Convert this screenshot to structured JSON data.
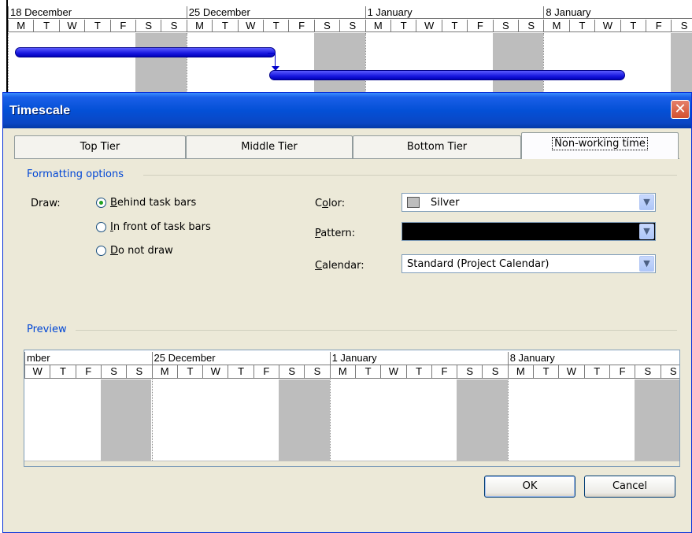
{
  "window": {
    "title": "Timescale",
    "close_glyph": "✕"
  },
  "timescale": {
    "weeks": [
      "18 December",
      "25 December",
      "1 January",
      "8 January"
    ],
    "days": [
      "M",
      "T",
      "W",
      "T",
      "F",
      "S",
      "S"
    ]
  },
  "tabs": [
    {
      "label": "Top Tier",
      "active": false
    },
    {
      "label": "Middle Tier",
      "active": false
    },
    {
      "label": "Bottom Tier",
      "active": false
    },
    {
      "label": "Non-working time",
      "active": true
    }
  ],
  "formatting": {
    "group_label": "Formatting options",
    "draw_label": "Draw:",
    "draw_options": [
      {
        "label": "Behind task bars",
        "selected": true
      },
      {
        "label": "In front of task bars",
        "selected": false
      },
      {
        "label": "Do not draw",
        "selected": false
      }
    ],
    "color_label": "Color:",
    "color_value": "Silver",
    "color_swatch": "#bdbdbd",
    "pattern_label": "Pattern:",
    "pattern_color": "#000000",
    "calendar_label": "Calendar:",
    "calendar_value": "Standard (Project Calendar)"
  },
  "preview": {
    "group_label": "Preview",
    "weeks": [
      "mber",
      "25 December",
      "1 January",
      "8 January"
    ],
    "days": [
      "W",
      "T",
      "F",
      "S",
      "S",
      "M",
      "T",
      "W",
      "T",
      "F",
      "S",
      "S",
      "M",
      "T",
      "W",
      "T",
      "F",
      "S",
      "S",
      "M",
      "T",
      "W",
      "T",
      "F",
      "S",
      "S"
    ]
  },
  "buttons": {
    "ok": "OK",
    "cancel": "Cancel"
  },
  "icons": {
    "dropdown": "chevron-down-icon",
    "close": "close-icon",
    "radio": "radio-icon"
  },
  "colors": {
    "title_bar": "#0450d6",
    "task_bar": "#1818e0",
    "nonworking": "#bdbdbd",
    "dialog_bg": "#ece9d8",
    "group_label": "#0046d5"
  }
}
